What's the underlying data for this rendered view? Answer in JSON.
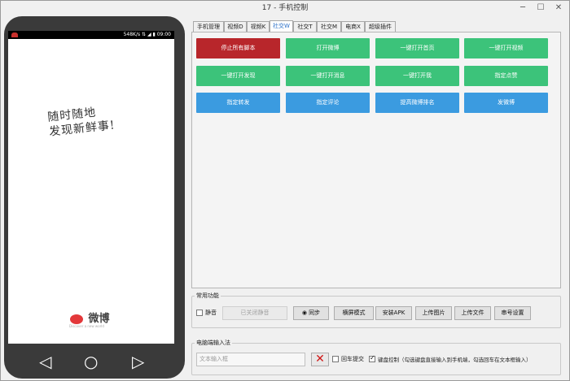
{
  "window": {
    "title": "17 - 手机控制",
    "minimize": "─",
    "maximize": "☐",
    "close": "✕"
  },
  "phone": {
    "status_text": "548K/s ⇅ ◢ ▮ 09:00",
    "slogan_line1": "随时随地",
    "slogan_line2": "发现新鲜事!",
    "logo_text": "微博",
    "logo_sub": "Discover a new world",
    "nav_back": "◁",
    "nav_home": "○",
    "nav_recent": "▷"
  },
  "tabs": [
    "手机管理",
    "视频D",
    "视频K",
    "社交W",
    "社交T",
    "社交M",
    "电商X",
    "超级插件"
  ],
  "actions": {
    "row1": [
      "停止所有脚本",
      "打开微博",
      "一键打开首页",
      "一键打开视频"
    ],
    "row2": [
      "一键打开发现",
      "一键打开消息",
      "一键打开我",
      "指定点赞"
    ],
    "row3": [
      "指定转发",
      "指定评论",
      "提高微博排名",
      "发微博"
    ]
  },
  "common": {
    "label": "常用功能",
    "mute_label": "静音",
    "closed_mute": "已关闭静音",
    "sync": "同步",
    "landscape": "横屏模式",
    "install_apk": "安装APK",
    "upload_image": "上传图片",
    "upload_file": "上传文件",
    "serial_settings": "串号设置"
  },
  "pc_input": {
    "label": "电脑端输入法",
    "placeholder": "文本输入框",
    "enter_submit": "回车提交",
    "keyboard_control": "键盘控制（勾选键盘直接输入到手机端，勾选回车在文本框输入）"
  },
  "colors": {
    "accent_green": "#3cc37a",
    "accent_blue": "#3b9be0",
    "stop_red": "#b8262b"
  }
}
